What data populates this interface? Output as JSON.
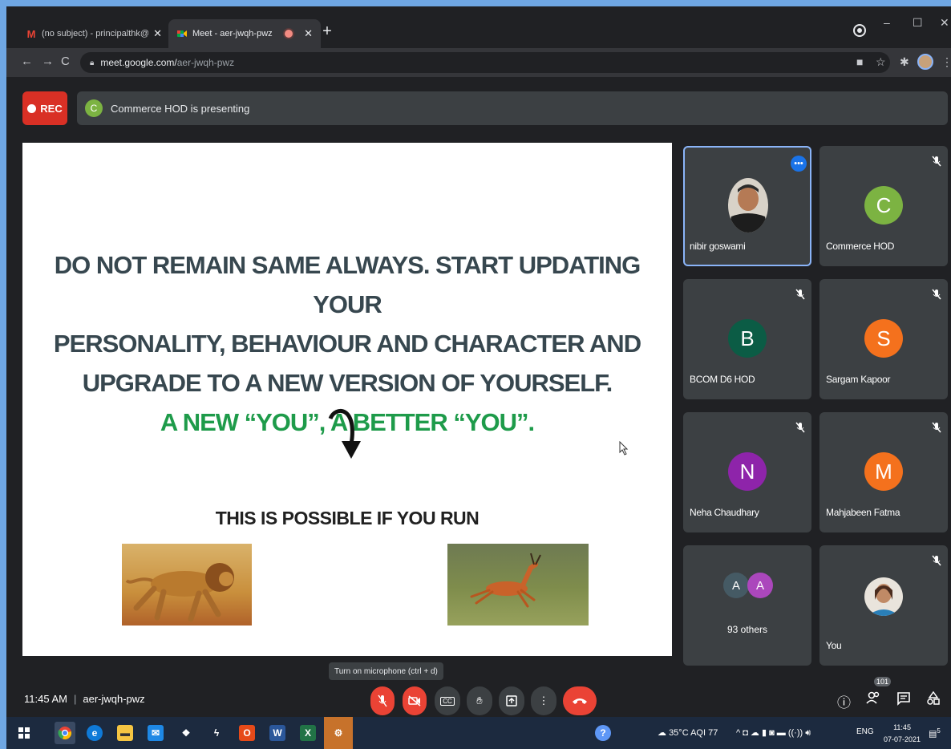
{
  "browser": {
    "tabs": [
      {
        "label": "(no subject) - principalthk@gmai",
        "favicon": "gmail-icon"
      },
      {
        "label": "Meet - aer-jwqh-pwz",
        "favicon": "meet-icon",
        "active": true
      }
    ],
    "url_host": "meet.google.com/",
    "url_path": "aer-jwqh-pwz"
  },
  "meet": {
    "rec_label": "REC",
    "presenter_initial": "C",
    "presenting_text": "Commerce HOD is presenting",
    "slide": {
      "line1": "DO NOT REMAIN SAME ALWAYS. START UPDATING YOUR",
      "line2": "PERSONALITY, BEHAVIOUR AND CHARACTER AND",
      "line3": "UPGRADE TO A NEW VERSION OF YOURSELF.",
      "line4": "A NEW “YOU”, A BETTER “YOU”.",
      "possible": "THIS IS POSSIBLE IF YOU RUN"
    },
    "participants": [
      {
        "name": "nibir goswami",
        "type": "photo"
      },
      {
        "name": "Commerce HOD",
        "initial": "C",
        "color": "#7cb342"
      },
      {
        "name": "BCOM D6 HOD",
        "initial": "B",
        "color": "#0b5c45"
      },
      {
        "name": "Sargam Kapoor",
        "initial": "S",
        "color": "#f4711d"
      },
      {
        "name": "Neha Chaudhary",
        "initial": "N",
        "color": "#8e24aa"
      },
      {
        "name": "Mahjabeen Fatma",
        "initial": "M",
        "color": "#f4711d"
      },
      {
        "name": "93 others",
        "initials": [
          "A",
          "A"
        ],
        "colors": [
          "#455a64",
          "#ab47bc"
        ]
      },
      {
        "name": "You",
        "type": "photo"
      }
    ],
    "tooltip": "Turn on microphone (ctrl + d)",
    "time": "11:45 AM",
    "meeting_code": "aer-jwqh-pwz",
    "people_count": "101",
    "cc_label": "CC"
  },
  "taskbar": {
    "weather": "35°C AQI 77",
    "lang": "ENG",
    "time": "11:45",
    "date": "07-07-2021",
    "notif_count": "5"
  }
}
